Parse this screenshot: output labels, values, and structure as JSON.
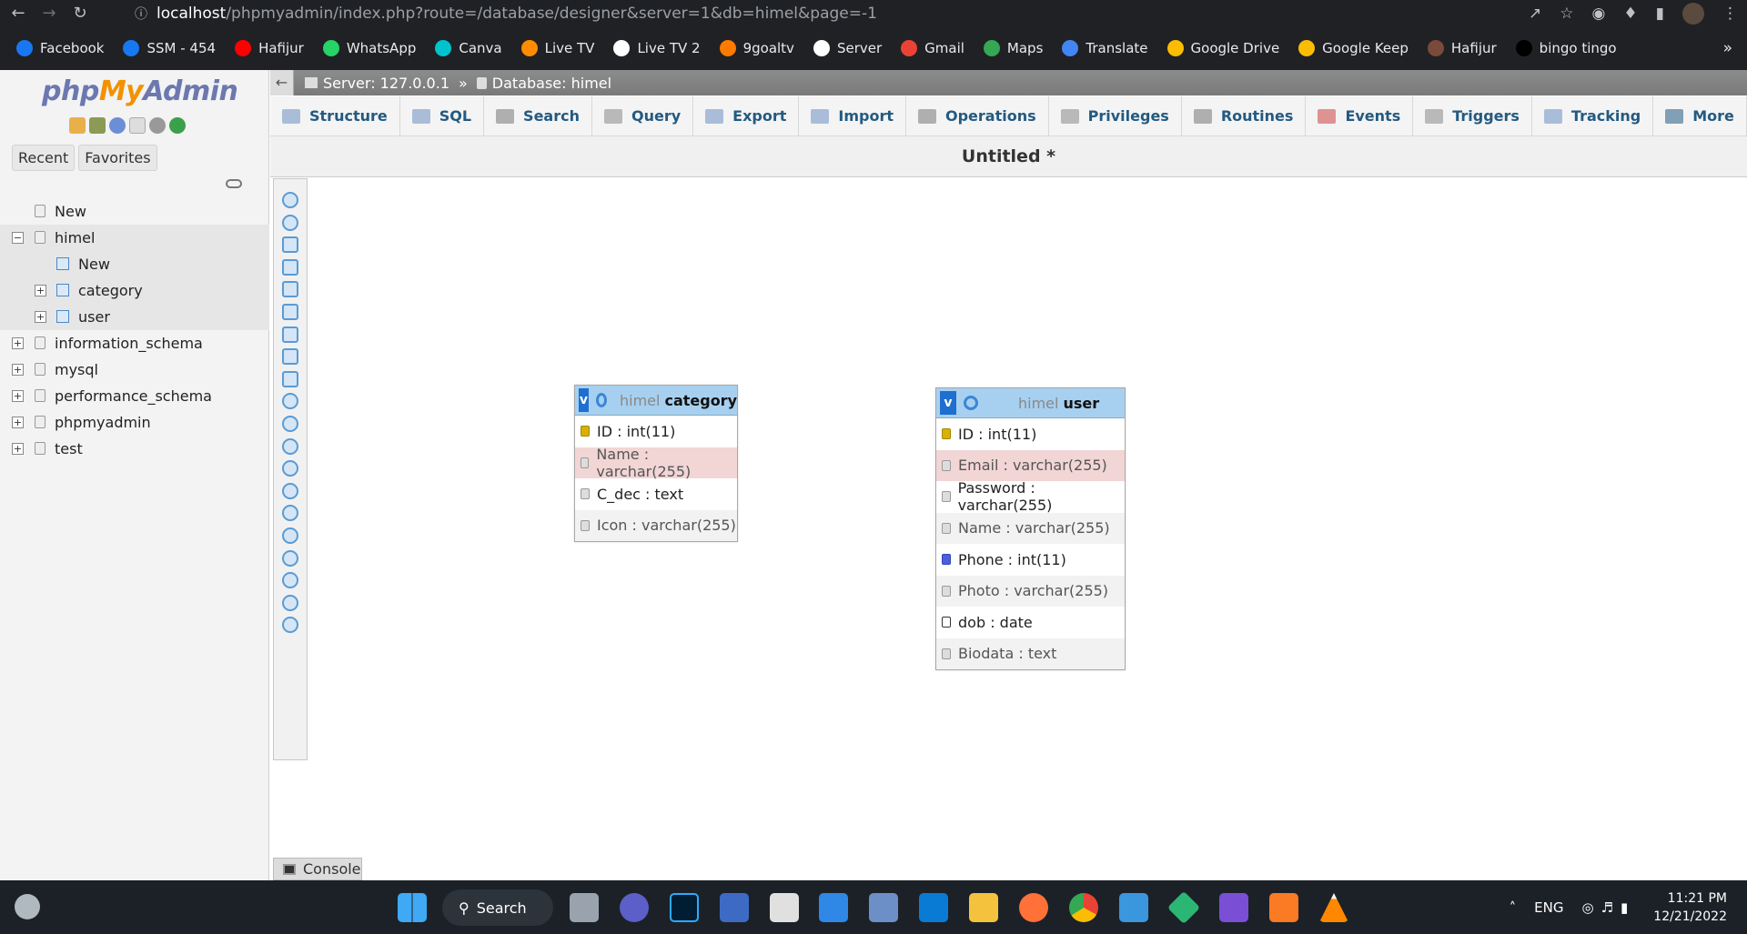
{
  "browser": {
    "url_host": "localhost",
    "url_path": "/phpmyadmin/index.php?route=/database/designer&server=1&db=himel&page=-1",
    "bookmarks": [
      {
        "label": "Facebook",
        "color": "#1877f2"
      },
      {
        "label": "SSM - 454",
        "color": "#1877f2"
      },
      {
        "label": "Hafijur",
        "color": "#ff0000"
      },
      {
        "label": "WhatsApp",
        "color": "#25d366"
      },
      {
        "label": "Canva",
        "color": "#00c4cc"
      },
      {
        "label": "Live TV",
        "color": "#ff8c00"
      },
      {
        "label": "Live TV 2",
        "color": "#ffffff"
      },
      {
        "label": "9goaltv",
        "color": "#ff7a00"
      },
      {
        "label": "Server",
        "color": "#ffffff"
      },
      {
        "label": "Gmail",
        "color": "#ea4335"
      },
      {
        "label": "Maps",
        "color": "#34a853"
      },
      {
        "label": "Translate",
        "color": "#4285f4"
      },
      {
        "label": "Google Drive",
        "color": "#fbbc04"
      },
      {
        "label": "Google Keep",
        "color": "#fbbc04"
      },
      {
        "label": "Hafijur",
        "color": "#7a4a3a"
      },
      {
        "label": "bingo tingo",
        "color": "#000000"
      }
    ]
  },
  "sidebar": {
    "logo_php": "php",
    "logo_my": "My",
    "logo_admin": "Admin",
    "recent": "Recent",
    "favorites": "Favorites",
    "tree": {
      "new": "New",
      "himel": "himel",
      "himel_new": "New",
      "category": "category",
      "user": "user",
      "information_schema": "information_schema",
      "mysql": "mysql",
      "performance_schema": "performance_schema",
      "phpmyadmin": "phpmyadmin",
      "test": "test"
    }
  },
  "header": {
    "server": "Server: 127.0.0.1",
    "sep": "»",
    "database": "Database: himel"
  },
  "tabs": [
    "Structure",
    "SQL",
    "Search",
    "Query",
    "Export",
    "Import",
    "Operations",
    "Privileges",
    "Routines",
    "Events",
    "Triggers",
    "Tracking",
    "More"
  ],
  "page_title": "Untitled *",
  "designer": {
    "category": {
      "db": "himel",
      "name": "category",
      "columns": [
        "ID : int(11)",
        "Name : varchar(255)",
        "C_dec : text",
        "Icon : varchar(255)"
      ]
    },
    "user": {
      "db": "himel",
      "name": "user",
      "columns": [
        "ID : int(11)",
        "Email : varchar(255)",
        "Password : varchar(255)",
        "Name : varchar(255)",
        "Phone : int(11)",
        "Photo : varchar(255)",
        "dob : date",
        "Biodata : text"
      ]
    }
  },
  "console": "Console",
  "taskbar": {
    "search": "Search",
    "lang": "ENG",
    "time": "11:21 PM",
    "date": "12/21/2022"
  }
}
